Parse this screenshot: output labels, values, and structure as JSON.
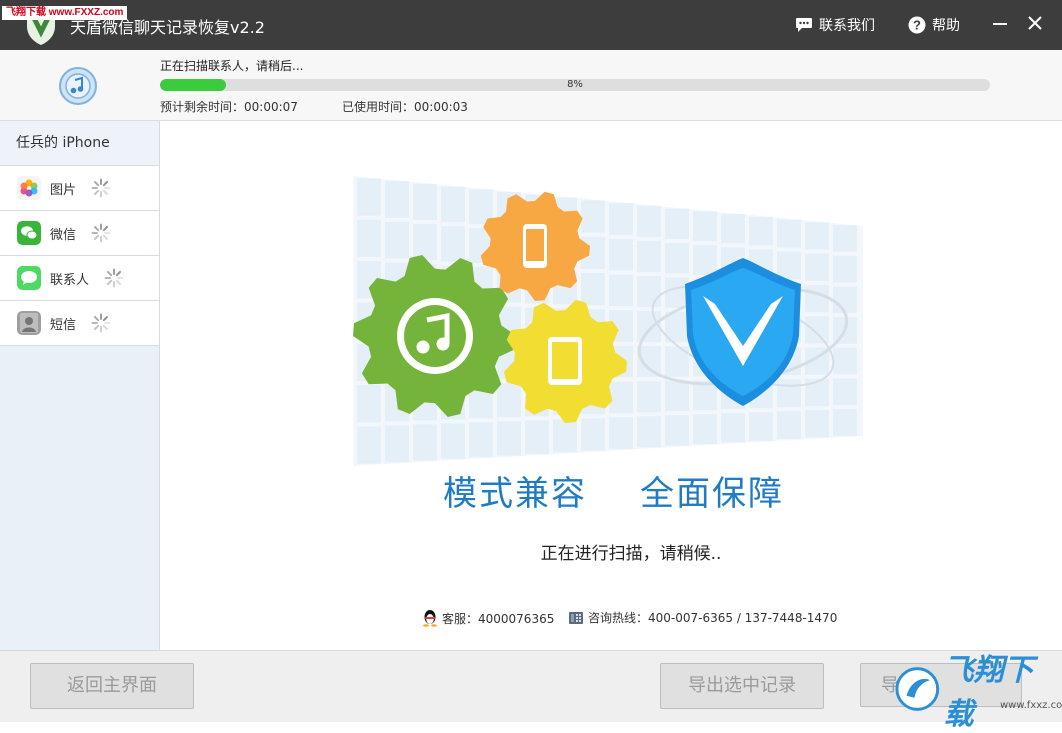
{
  "titlebar": {
    "watermark": "飞翔下载 www.FXXZ.com",
    "title": "天盾微信聊天记录恢复v2.2",
    "contact_label": "联系我们",
    "help_label": "帮助",
    "minimize_icon": "minimize-icon",
    "close_icon": "close-icon"
  },
  "progress": {
    "status": "正在扫描联系人，请稍后...",
    "percent_label": "8%",
    "percent_value": 8,
    "remaining_label": "预计剩余时间：00:00:07",
    "used_label": "已使用时间：00:00:03"
  },
  "sidebar": {
    "device_name": "任兵的 iPhone",
    "items": [
      {
        "label": "图片",
        "icon": "photos-icon"
      },
      {
        "label": "微信",
        "icon": "wechat-icon"
      },
      {
        "label": "联系人",
        "icon": "messages-icon"
      },
      {
        "label": "短信",
        "icon": "contacts-icon"
      }
    ]
  },
  "main": {
    "slogan_left": "模式兼容",
    "slogan_right": "全面保障",
    "scanning_text": "正在进行扫描，请稍候..",
    "support": "客服：4000076365",
    "hotline": "咨询热线：400-007-6365 / 137-7448-1470"
  },
  "footer": {
    "home_button": "返回主界面",
    "export_selected_button": "导出选中记录",
    "export_all_button": "导",
    "watermark": "飞翔下载",
    "watermark_url": "www.fxxz.com"
  },
  "colors": {
    "titlebar": "#3d3d3d",
    "progress_fill": "#3ccb3c",
    "accent_blue": "#1f7cc4",
    "sidebar_bg": "#e9f0f8"
  }
}
